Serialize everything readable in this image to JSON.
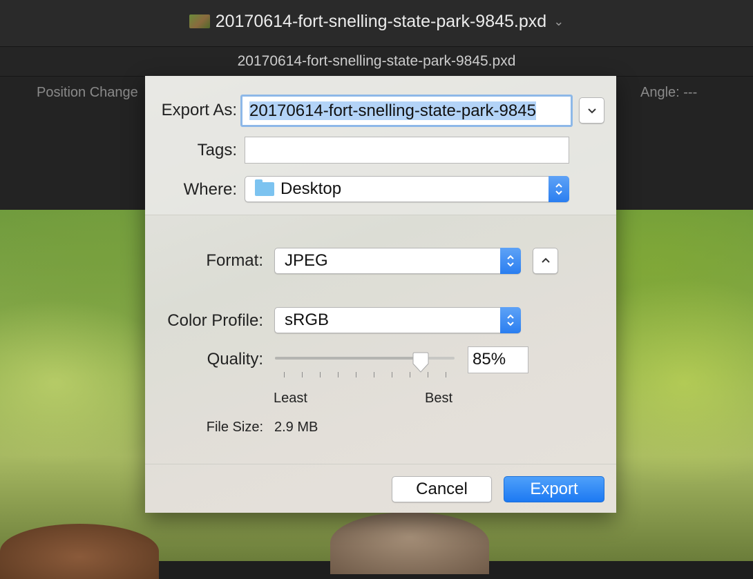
{
  "window": {
    "title": "20170614-fort-snelling-state-park-9845.pxd"
  },
  "document": {
    "tab_title": "20170614-fort-snelling-state-park-9845.pxd"
  },
  "info_bar": {
    "left_text": "Position Change",
    "right_text": "Angle: ---"
  },
  "export_dialog": {
    "export_as_label": "Export As:",
    "export_as_value": "20170614-fort-snelling-state-park-9845",
    "tags_label": "Tags:",
    "tags_value": "",
    "where_label": "Where:",
    "where_value": "Desktop",
    "where_icon": "folder-icon",
    "format_label": "Format:",
    "format_value": "JPEG",
    "color_profile_label": "Color Profile:",
    "color_profile_value": "sRGB",
    "quality_label": "Quality:",
    "quality_value": "85%",
    "quality_fraction": 0.81,
    "quality_min_label": "Least",
    "quality_max_label": "Best",
    "file_size_label": "File Size:",
    "file_size_value": "2.9 MB",
    "cancel_label": "Cancel",
    "export_label": "Export"
  },
  "colors": {
    "accent": "#2a7ef0",
    "selection": "#b3d3f7",
    "dialog_bg": "#e3e3de"
  }
}
